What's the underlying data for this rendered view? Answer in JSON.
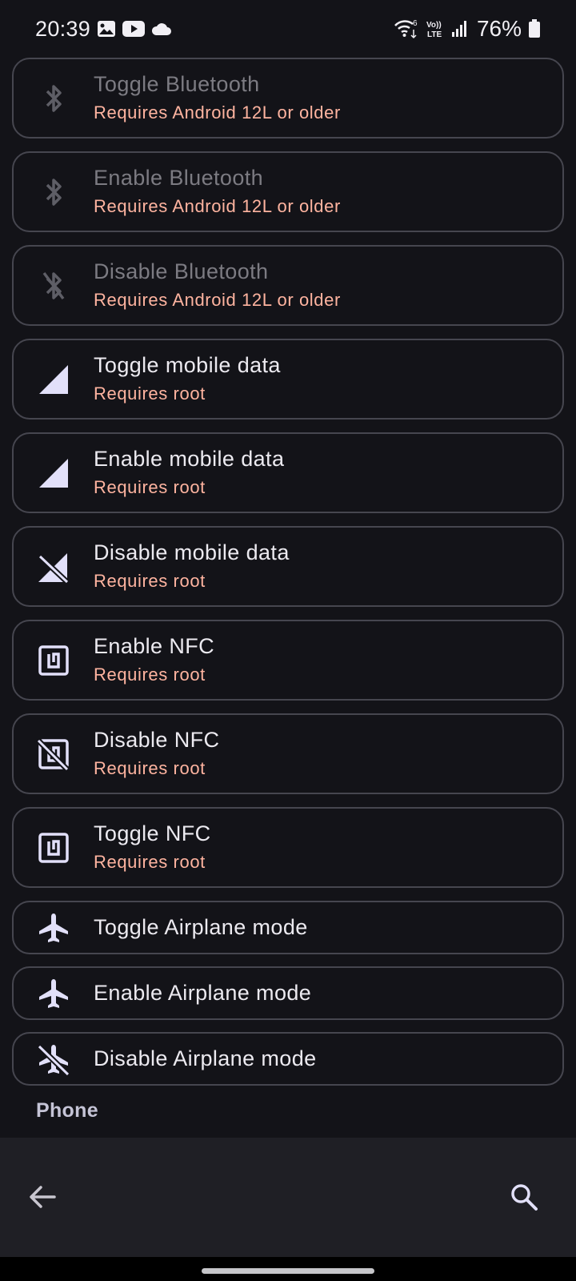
{
  "status_bar": {
    "time": "20:39",
    "battery": "76%",
    "notification_icons": [
      "gallery-icon",
      "youtube-icon",
      "cloud-icon"
    ],
    "system_icons": [
      "wifi-6-icon",
      "volte-icon",
      "signal-icon",
      "battery-icon"
    ],
    "wifi_label": "6",
    "volte_top": "Vo))",
    "volte_bottom": "LTE"
  },
  "actions": [
    {
      "icon": "bluetooth-icon",
      "title": "Toggle Bluetooth",
      "subtitle": "Requires Android 12L or older",
      "enabled": false
    },
    {
      "icon": "bluetooth-icon",
      "title": "Enable Bluetooth",
      "subtitle": "Requires Android 12L or older",
      "enabled": false
    },
    {
      "icon": "bluetooth-disabled-icon",
      "title": "Disable Bluetooth",
      "subtitle": "Requires Android 12L or older",
      "enabled": false
    },
    {
      "icon": "mobile-data-icon",
      "title": "Toggle mobile data",
      "subtitle": "Requires root",
      "enabled": true
    },
    {
      "icon": "mobile-data-icon",
      "title": "Enable mobile data",
      "subtitle": "Requires root",
      "enabled": true
    },
    {
      "icon": "mobile-data-off-icon",
      "title": "Disable mobile data",
      "subtitle": "Requires root",
      "enabled": true
    },
    {
      "icon": "nfc-icon",
      "title": "Enable NFC",
      "subtitle": "Requires root",
      "enabled": true
    },
    {
      "icon": "nfc-off-icon",
      "title": "Disable NFC",
      "subtitle": "Requires root",
      "enabled": true
    },
    {
      "icon": "nfc-icon",
      "title": "Toggle NFC",
      "subtitle": "Requires root",
      "enabled": true
    },
    {
      "icon": "airplane-icon",
      "title": "Toggle Airplane mode",
      "enabled": true
    },
    {
      "icon": "airplane-icon",
      "title": "Enable Airplane mode",
      "enabled": true
    },
    {
      "icon": "airplane-off-icon",
      "title": "Disable Airplane mode",
      "enabled": true
    }
  ],
  "section_header": "Phone",
  "bottom_bar": {
    "back": "back-arrow-icon",
    "search": "search-icon"
  },
  "colors": {
    "background": "#131318",
    "card_border": "#46464f",
    "subtitle": "#ffb4a0",
    "disabled_text": "#7c7b82",
    "bottom_bar": "#1f1f25"
  }
}
